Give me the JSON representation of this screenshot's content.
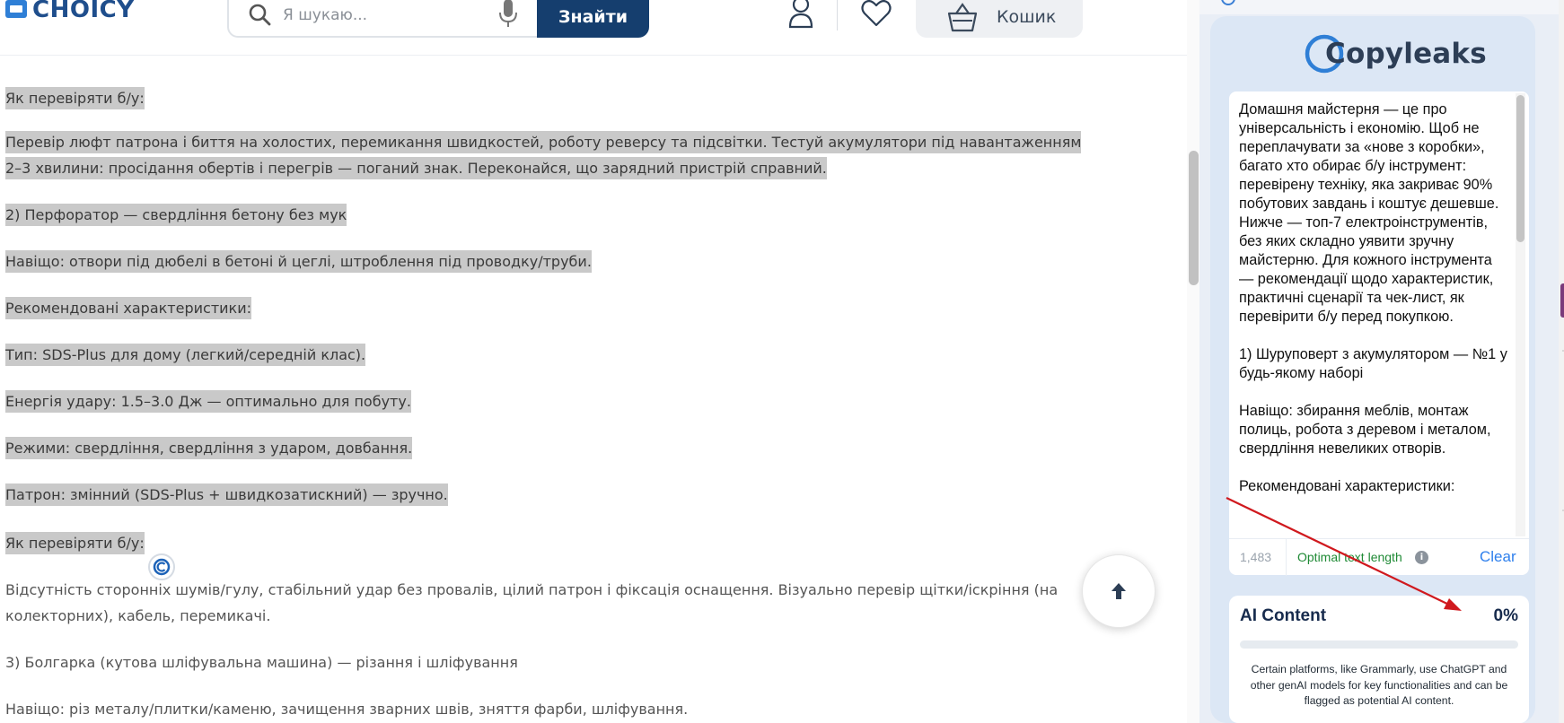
{
  "header": {
    "logo_text": "CHOICY",
    "search": {
      "placeholder": "Я шукаю..."
    },
    "find_button": "Знайти",
    "cart_label": "Кошик"
  },
  "article": {
    "lines": [
      {
        "text": "Як перевіряти б/у:",
        "highlighted": true
      },
      {
        "text": "Перевір люфт патрона і биття на холостих, перемикання швидкостей, роботу реверсу та підсвітки. Тестуй акумулятори під навантаженням",
        "highlighted": true
      },
      {
        "text": "2–3 хвилини: просідання обертів і перегрів — поганий знак. Переконайся, що зарядний пристрій справний.",
        "highlighted": true
      },
      {
        "text": "2) Перфоратор — свердління бетону без мук",
        "highlighted": true
      },
      {
        "text": "Навіщо: отвори під дюбелі в бетоні й цеглі, штроблення під проводку/труби.",
        "highlighted": true
      },
      {
        "text": "Рекомендовані характеристики:",
        "highlighted": true
      },
      {
        "text": "Тип: SDS-Plus для дому (легкий/середній клас).",
        "highlighted": true
      },
      {
        "text": "Енергія удару: 1.5–3.0 Дж — оптимально для побуту.",
        "highlighted": true
      },
      {
        "text": "Режими: свердління, свердління з ударом, довбання.",
        "highlighted": true
      },
      {
        "text": "Патрон: змінний (SDS-Plus + швидкозатискний) — зручно.",
        "highlighted": true
      },
      {
        "text": "Як перевіряти б/у:",
        "highlighted": true
      },
      {
        "text": "Відсутність сторонніх шумів/гулу, стабільний удар без провалів, цілий патрон і фіксація оснащення. Візуально перевір щітки/іскріння (на",
        "highlighted": false
      },
      {
        "text": "колекторних), кабель, перемикачі.",
        "highlighted": false
      },
      {
        "text": "3) Болгарка (кутова шліфувальна машина) — різання і шліфування",
        "highlighted": false
      },
      {
        "text": "Навіщо: різ металу/плитки/каменю, зачищення зварних швів, зняття фарби, шліфування.",
        "highlighted": false
      }
    ]
  },
  "copyleaks": {
    "logo_text": "Copyleaks",
    "input_text": "Домашня майстерня — це про універсальність і економію. Щоб не переплачувати за «нове з коробки», багато хто обирає б/у інструмент: перевірену техніку, яка закриває 90% побутових завдань і коштує дешевше. Нижче — топ-7 електроінструментів, без яких складно уявити зручну майстерню. Для кожного інструмента — рекомендації щодо характеристик, практичні сценарії та чек-лист, як перевірити б/у перед покупкою.\n\n1) Шуруповерт з акумулятором — №1 у будь-якому наборі\n\nНавіщо: збирання меблів, монтаж полиць, робота з деревом і металом, свердління невеликих отворів.\n\nРекомендовані характеристики:",
    "char_count": "1,483",
    "length_status": "Optimal text length",
    "clear_label": "Clear",
    "ai_title": "AI Content",
    "ai_percent": "0%",
    "ai_fraction": 0,
    "ai_description": "Certain platforms, like Grammarly, use ChatGPT and other genAI models for key functionalities and can be flagged as potential AI content."
  },
  "colors": {
    "brand_blue": "#153e6e",
    "highlight_gray": "#c9c9c9",
    "optimal_green": "#1f8a35",
    "clear_blue": "#2f80ed",
    "arrow_red": "#d0191e"
  }
}
